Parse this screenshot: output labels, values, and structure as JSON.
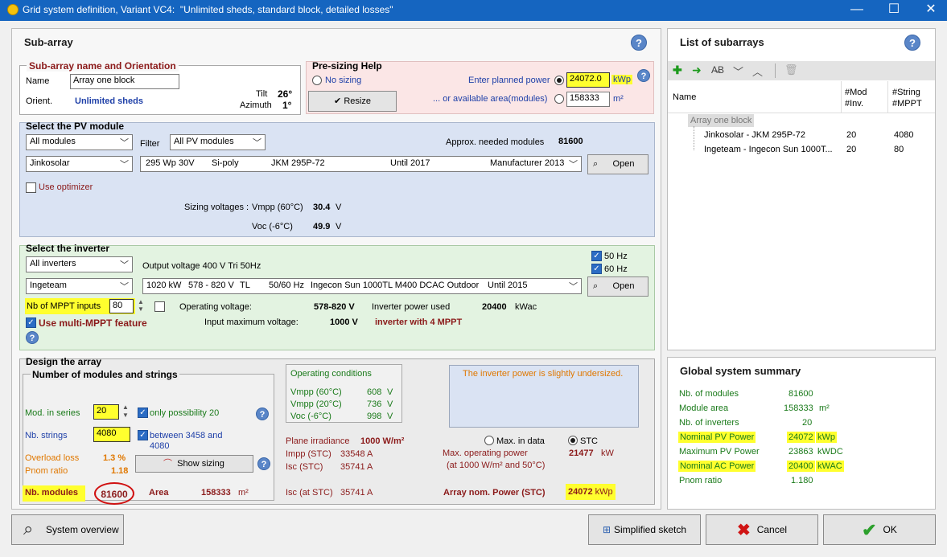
{
  "window": {
    "title": "Grid system definition, Variant VC4:  \"Unlimited sheds, standard block, detailed losses\"",
    "minimize": "—",
    "maximize": "☐",
    "close": "✕"
  },
  "subarray": {
    "title": "Sub-array",
    "help": "?",
    "name_group": {
      "title": "Sub-array name and Orientation",
      "name_label": "Name",
      "name_value": "Array one block",
      "orient_label": "Orient.",
      "orient_value": "Unlimited sheds",
      "tilt_label": "Tilt",
      "tilt_value": "26°",
      "azimuth_label": "Azimuth",
      "azimuth_value": "1°"
    },
    "presizing": {
      "title": "Pre-sizing Help",
      "no_sizing": "No sizing",
      "resize": "Resize",
      "resize_icon": "checkmark-icon",
      "planned_power_label": "Enter planned power",
      "planned_power_value": "24072.0",
      "planned_power_unit": "kWp",
      "area_label": "... or available area(modules)",
      "area_value": "158333",
      "area_unit": "m²"
    },
    "pv_module": {
      "title": "Select the PV module",
      "filter_all": "All modules",
      "filter_label": "Filter",
      "filter_value": "All PV modules",
      "approx_label": "Approx. needed modules",
      "approx_value": "81600",
      "manufacturer": "Jinkosolar",
      "spec_power": "295 Wp 30V",
      "spec_tech": "Si-poly",
      "spec_model": "JKM 295P-72",
      "spec_until": "Until 2017",
      "spec_source": "Manufacturer 2013",
      "open": "Open",
      "use_optimizer": "Use optimizer",
      "sizing_label": "Sizing voltages :",
      "vmpp_label": "Vmpp (60°C)",
      "vmpp_value": "30.4",
      "vmpp_unit": "V",
      "voc_label": "Voc (-6°C)",
      "voc_value": "49.9",
      "voc_unit": "V"
    },
    "inverter": {
      "title": "Select the inverter",
      "filter_all": "All inverters",
      "output_voltage": "Output voltage 400 V Tri 50Hz",
      "hz50": "50 Hz",
      "hz60": "60 Hz",
      "manufacturer": "Ingeteam",
      "spec_power": "1020 kW",
      "spec_range": "578 - 820 V",
      "spec_tl": "TL",
      "spec_freq": "50/60 Hz",
      "spec_model": "Ingecon Sun 1000TL M400 DCAC Outdoor",
      "spec_until": "Until 2015",
      "open": "Open",
      "mppt_label": "Nb of MPPT inputs",
      "mppt_value": "80",
      "op_voltage_label": "Operating voltage:",
      "op_voltage_value": "578-820 V",
      "inv_power_label": "Inverter power used",
      "inv_power_value": "20400",
      "inv_power_unit": "kWac",
      "multi_mppt": "Use multi-MPPT feature",
      "input_max_label": "Input maximum voltage:",
      "input_max_value": "1000 V",
      "inv_note": "inverter with 4 MPPT",
      "help": "?"
    },
    "design": {
      "title": "Design the array",
      "group_title": "Number of modules and strings",
      "series_label": "Mod. in series",
      "series_value": "20",
      "only_possibility": "only possibility 20",
      "strings_label": "Nb. strings",
      "strings_value": "4080",
      "between_line1": "between 3458 and",
      "between_line2": "4080",
      "overload_label": "Overload loss",
      "overload_value": "1.3 %",
      "pnom_label": "Pnom ratio",
      "pnom_value": "1.18",
      "show_sizing": "Show sizing",
      "nb_modules_label": "Nb. modules",
      "nb_modules_value": "81600",
      "area_label": "Area",
      "area_value": "158333",
      "area_unit": "m²",
      "op_cond_title": "Operating conditions",
      "vmpp60_label": "Vmpp (60°C)",
      "vmpp60_value": "608",
      "vmpp60_unit": "V",
      "vmpp20_label": "Vmpp (20°C)",
      "vmpp20_value": "736",
      "vmpp20_unit": "V",
      "voc_label": "Voc (-6°C)",
      "voc_value": "998",
      "voc_unit": "V",
      "message": "The inverter power is slightly undersized.",
      "max_in_data": "Max. in data",
      "stc": "STC",
      "irr_label": "Plane irradiance",
      "irr_value": "1000 W/m²",
      "impp_label": "Impp (STC)",
      "impp_value": "33548 A",
      "isc_label": "Isc (STC)",
      "isc_value": "35741 A",
      "max_op_label": "Max. operating power",
      "max_op_sub": "(at 1000 W/m² and 50°C)",
      "max_op_value": "21477",
      "max_op_unit": "kW",
      "isc_at_label": "Isc (at STC)",
      "isc_at_value": "35741 A",
      "array_nom_label": "Array nom. Power (STC)",
      "array_nom_value": "24072",
      "array_nom_unit": "kWp"
    }
  },
  "list": {
    "title": "List of subarrays",
    "help": "?",
    "col_name": "Name",
    "col_mod1": "#Mod",
    "col_mod2": "#Inv.",
    "col_str1": "#String",
    "col_str2": "#MPPT",
    "root": "Array one block",
    "rows": [
      {
        "name": "Jinkosolar - JKM 295P-72",
        "mod": "20",
        "str": "4080"
      },
      {
        "name": "Ingeteam - Ingecon Sun 1000T...",
        "mod": "20",
        "str": "80"
      }
    ]
  },
  "summary": {
    "title": "Global system summary",
    "rows": [
      {
        "label": "Nb. of modules",
        "value": "81600",
        "unit": ""
      },
      {
        "label": "Module area",
        "value": "158333",
        "unit": "m²"
      },
      {
        "label": "Nb. of inverters",
        "value": "20",
        "unit": ""
      },
      {
        "label": "Nominal PV Power",
        "value": "24072",
        "unit": "kWp"
      },
      {
        "label": "Maximum PV Power",
        "value": "23863",
        "unit": "kWDC"
      },
      {
        "label": "Nominal AC Power",
        "value": "20400",
        "unit": "kWAC"
      },
      {
        "label": "Pnom ratio",
        "value": "1.180",
        "unit": ""
      }
    ]
  },
  "footer": {
    "system_overview": "System overview",
    "simplified_sketch": "Simplified sketch",
    "cancel": "Cancel",
    "ok": "OK"
  }
}
